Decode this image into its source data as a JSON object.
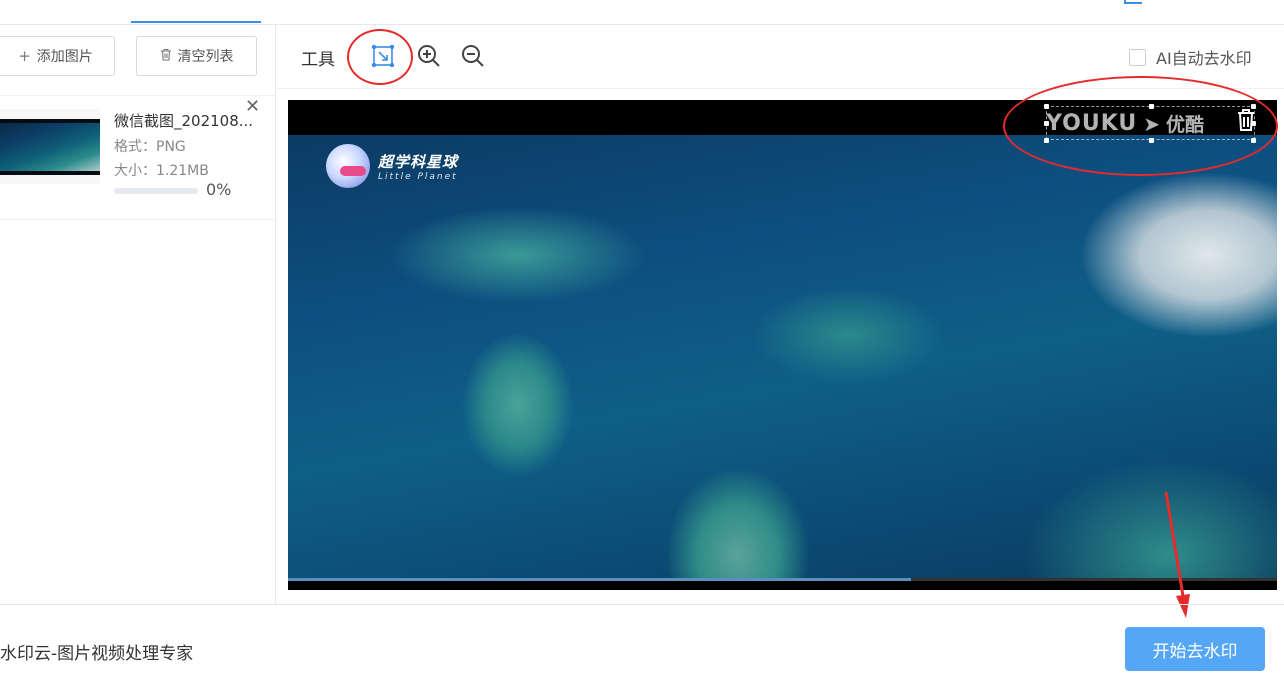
{
  "toolbar_left": {
    "add_image_label": "添加图片",
    "clear_list_label": "清空列表"
  },
  "file": {
    "name": "微信截图_202108...",
    "format": "格式：PNG",
    "size": "大小：1.21MB",
    "progress_text": "0%",
    "progress_value": 0
  },
  "tools": {
    "label": "工具",
    "icons": [
      "rect-select-icon",
      "zoom-in-icon",
      "zoom-out-icon"
    ]
  },
  "ai_option": {
    "label": "AI自动去水印",
    "checked": false
  },
  "image": {
    "logo_title": "超学科星球",
    "logo_subtitle": "Little Planet",
    "watermark_brand": "YOUKU",
    "watermark_arrow": "➤",
    "watermark_cn": "优酷",
    "video_progress": 0.63
  },
  "footer": {
    "app_title": "水印云-图片视频处理专家",
    "start_button": "开始去水印"
  },
  "colors": {
    "accent": "#3a8ee6",
    "start_button": "#55a7f5",
    "annotation_red": "#e52b2b"
  }
}
